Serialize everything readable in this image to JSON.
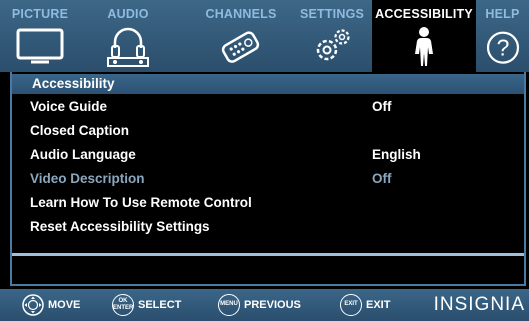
{
  "tabs": [
    {
      "label": "PICTURE",
      "icon": "tv-icon"
    },
    {
      "label": "AUDIO",
      "icon": "headphones-icon"
    },
    {
      "label": "CHANNELS",
      "icon": "remote-icon"
    },
    {
      "label": "SETTINGS",
      "icon": "gears-icon"
    },
    {
      "label": "ACCESSIBILITY",
      "icon": "person-icon",
      "active": true
    },
    {
      "label": "HELP",
      "icon": "question-icon"
    }
  ],
  "menu": {
    "title": "Accessibility",
    "items": [
      {
        "label": "Voice Guide",
        "value": "Off"
      },
      {
        "label": "Closed Caption",
        "value": ""
      },
      {
        "label": "Audio Language",
        "value": "English"
      },
      {
        "label": "Video Description",
        "value": "Off",
        "disabled": true
      },
      {
        "label": "Learn How To Use Remote Control",
        "value": ""
      },
      {
        "label": "Reset Accessibility Settings",
        "value": ""
      }
    ]
  },
  "bottom_bar": {
    "hints": [
      {
        "icon": "dpad-icon",
        "label": "MOVE"
      },
      {
        "icon": "ok-enter-button-icon",
        "icon_text": "OK\nENTER",
        "label": "SELECT"
      },
      {
        "icon": "menu-button-icon",
        "icon_text": "MENU",
        "label": "PREVIOUS"
      },
      {
        "icon": "exit-button-icon",
        "icon_text": "EXIT",
        "label": "EXIT"
      }
    ],
    "brand": "INSIGNIA"
  },
  "colors": {
    "bar": "#2f5677",
    "inactive_tab_text": "#8ebbe0",
    "disabled_text": "#8aa7bd"
  }
}
